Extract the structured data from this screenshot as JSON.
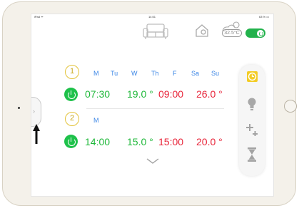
{
  "status_bar": {
    "carrier": "iPad ᯤ",
    "time": "14:51",
    "battery": "63 % ▭"
  },
  "header": {
    "outside_temp": "32.5°C"
  },
  "schedules": [
    {
      "index": "1",
      "days": [
        "M",
        "Tu",
        "W",
        "Th",
        "F",
        "Sa",
        "Su"
      ],
      "start_time": "07:30",
      "start_temp": "19.0 °",
      "end_time": "09:00",
      "end_temp": "26.0 °"
    },
    {
      "index": "2",
      "days": [
        "M"
      ],
      "start_time": "14:00",
      "start_temp": "15.0 °",
      "end_time": "15:00",
      "end_temp": "20.0 °"
    }
  ],
  "collapse_tab": {
    "glyph": "›"
  },
  "colors": {
    "accent_green": "#1fb83a",
    "accent_red": "#e8253a",
    "day_blue": "#3a85e6",
    "index_gold": "#e3c33a"
  },
  "icons": [
    "sofa-icon",
    "house-settings-icon",
    "weather-icon",
    "power-icon",
    "clock-icon",
    "lightbulb-icon",
    "plus-minus-icon",
    "hourglass-icon",
    "chevron-down-icon",
    "arrow-up-icon"
  ]
}
